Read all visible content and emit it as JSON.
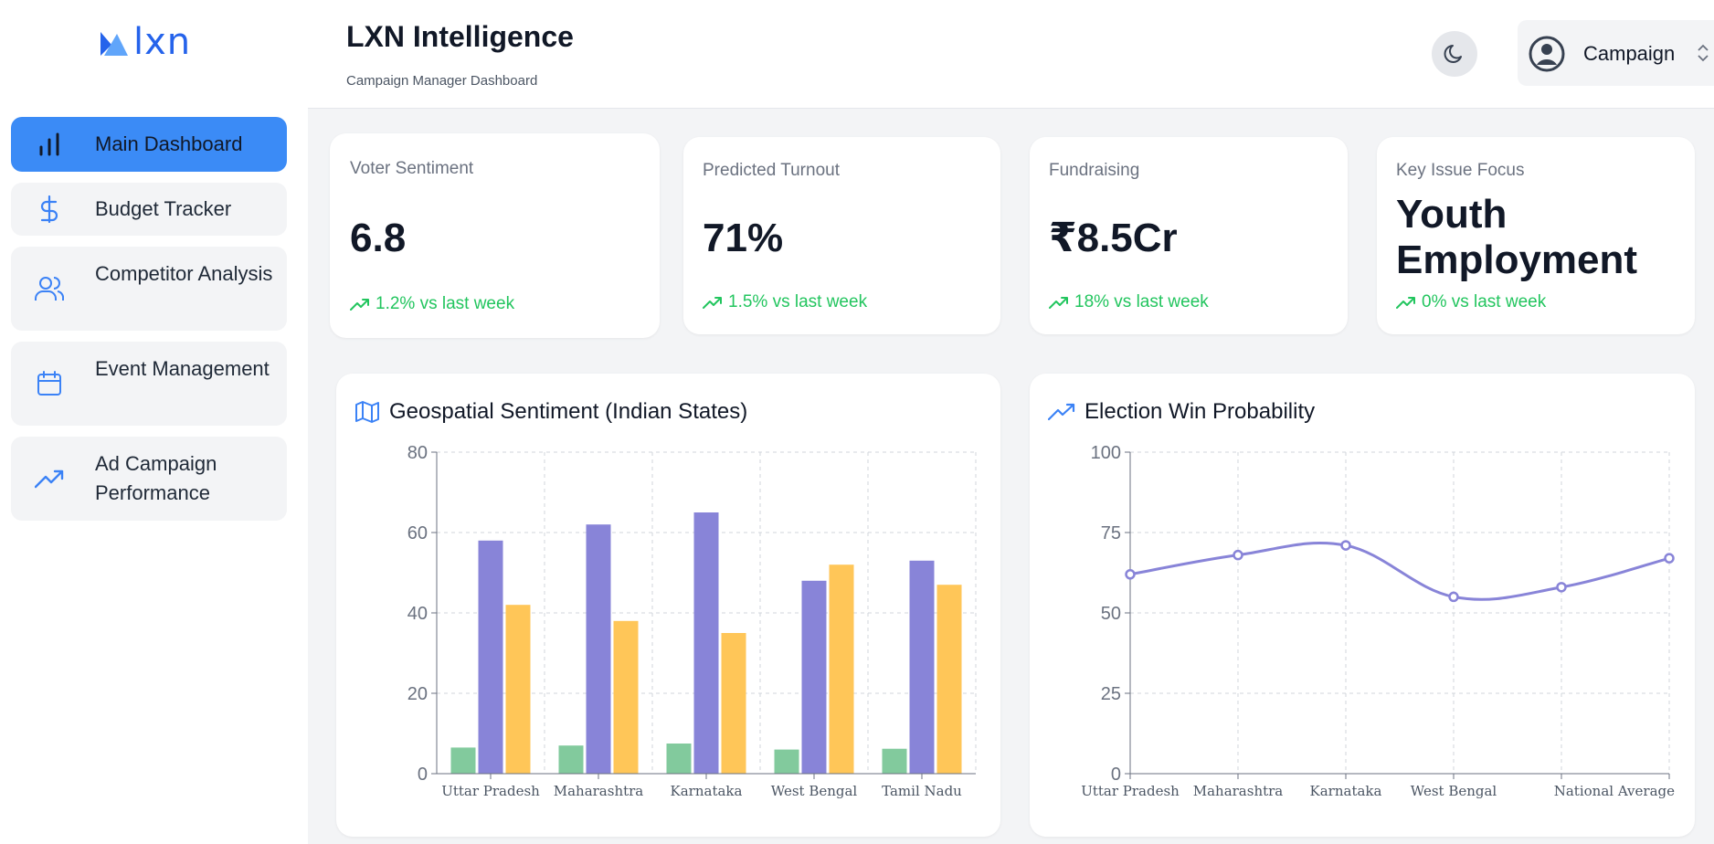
{
  "app": {
    "title": "LXN Intelligence",
    "subtitle": "Campaign Manager Dashboard",
    "logo_text": "lxn"
  },
  "sidebar": {
    "items": [
      {
        "label": "Main Dashboard",
        "icon": "bar-chart-icon",
        "active": true
      },
      {
        "label": "Budget Tracker",
        "icon": "dollar-icon",
        "active": false
      },
      {
        "label": "Competitor Analysis",
        "icon": "users-icon",
        "active": false
      },
      {
        "label": "Event Management",
        "icon": "calendar-icon",
        "active": false
      },
      {
        "label": "Ad Campaign Performance",
        "icon": "trending-up-icon",
        "active": false
      }
    ]
  },
  "header": {
    "theme_toggle_icon": "moon-icon",
    "campaign_select": {
      "value": "Campaign",
      "icon": "user-circle-icon"
    }
  },
  "kpis": [
    {
      "label": "Voter Sentiment",
      "value": "6.8",
      "trend": "1.2% vs last week"
    },
    {
      "label": "Predicted Turnout",
      "value": "71%",
      "trend": "1.5% vs last week"
    },
    {
      "label": "Fundraising",
      "value": "₹8.5Cr",
      "trend": "18% vs last week"
    },
    {
      "label": "Key Issue Focus",
      "value": "Youth Employment",
      "trend": "0% vs last week"
    }
  ],
  "colors": {
    "accent": "#3b8bf6",
    "trend_up": "#22c55e",
    "series_green": "#82ca9d",
    "series_purple": "#8884d8",
    "series_yellow": "#ffc658"
  },
  "chart_data": [
    {
      "type": "bar",
      "title": "Geospatial Sentiment (Indian States)",
      "title_icon": "map-icon",
      "categories": [
        "Uttar Pradesh",
        "Maharashtra",
        "Karnataka",
        "West Bengal",
        "Tamil Nadu"
      ],
      "series": [
        {
          "values": [
            6.5,
            7.0,
            7.5,
            6.0,
            6.2
          ],
          "color": "#82ca9d"
        },
        {
          "values": [
            58,
            62,
            65,
            48,
            53
          ],
          "color": "#8884d8"
        },
        {
          "values": [
            42,
            38,
            35,
            52,
            47
          ],
          "color": "#ffc658"
        }
      ],
      "ylim": [
        0,
        80
      ],
      "yticks": [
        0,
        20,
        40,
        60,
        80
      ],
      "grid": true
    },
    {
      "type": "line",
      "title": "Election Win Probability",
      "title_icon": "trending-up-icon",
      "categories": [
        "Uttar Pradesh",
        "Maharashtra",
        "Karnataka",
        "West Bengal",
        "",
        "National Average"
      ],
      "series": [
        {
          "values": [
            62,
            68,
            71,
            55,
            58,
            67
          ],
          "color": "#8884d8"
        }
      ],
      "ylim": [
        0,
        100
      ],
      "yticks": [
        0,
        25,
        50,
        75,
        100
      ],
      "grid": true
    }
  ]
}
